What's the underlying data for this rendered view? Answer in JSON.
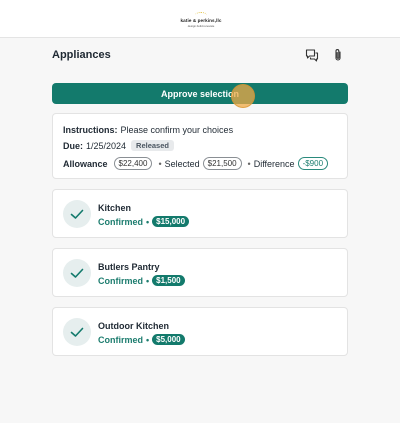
{
  "header": {
    "logo_text": "katie & perkins,llc",
    "logo_sub": "design.build.renovate"
  },
  "section": {
    "title": "Appliances",
    "icons": [
      "comments-icon",
      "paperclip-icon"
    ]
  },
  "approve_button": {
    "label": "Approve selection"
  },
  "instructions": {
    "label": "Instructions:",
    "text": "Please confirm your choices",
    "due_label": "Due:",
    "due_date": "1/25/2024",
    "status": "Released",
    "allowance_label": "Allowance",
    "allowance_value": "$22,400",
    "sep1": "•",
    "selected_label": "Selected",
    "selected_value": "$21,500",
    "sep2": "•",
    "difference_label": "Difference",
    "difference_value": "-$900"
  },
  "locations": [
    {
      "name": "Kitchen",
      "status": "Confirmed",
      "sep": "•",
      "amount": "$15,000"
    },
    {
      "name": "Butlers Pantry",
      "status": "Confirmed",
      "sep": "•",
      "amount": "$1,500"
    },
    {
      "name": "Outdoor Kitchen",
      "status": "Confirmed",
      "sep": "•",
      "amount": "$5,000"
    }
  ],
  "colors": {
    "accent": "#137a6c",
    "background": "#f7f7f7",
    "cursor": "#efaa46"
  }
}
